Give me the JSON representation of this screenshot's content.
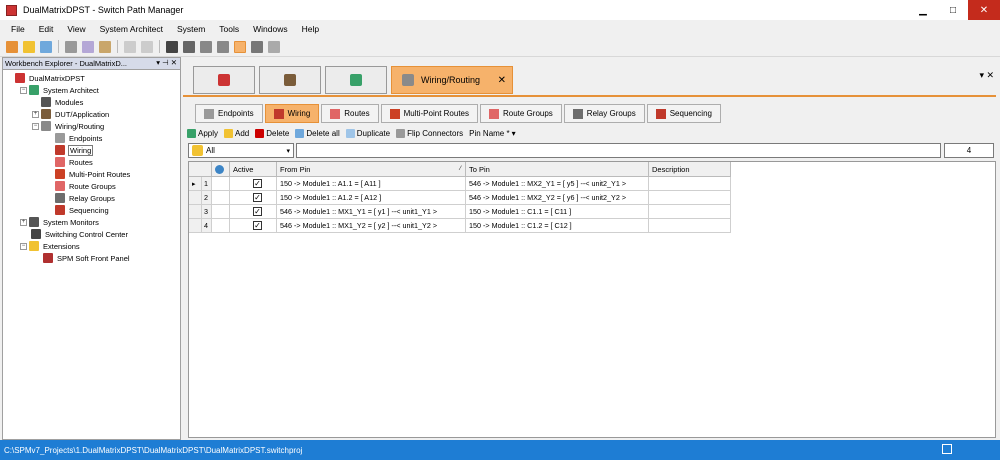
{
  "window": {
    "title": "DualMatrixDPST - Switch Path Manager",
    "minimize": "▁",
    "maximize": "□",
    "close": "✕"
  },
  "menu": [
    "File",
    "Edit",
    "View",
    "System Architect",
    "System",
    "Tools",
    "Windows",
    "Help"
  ],
  "explorer": {
    "title": "Workbench Explorer - DualMatrixD...",
    "controls": "▾ ⊣ ✕",
    "tree": [
      {
        "label": "DualMatrixDPST",
        "expander": "",
        "level": 0
      },
      {
        "label": "System Architect",
        "expander": "−",
        "level": 1
      },
      {
        "label": "Modules",
        "expander": "",
        "level": 2
      },
      {
        "label": "DUT/Application",
        "expander": "+",
        "level": 2
      },
      {
        "label": "Wiring/Routing",
        "expander": "−",
        "level": 2
      },
      {
        "label": "Endpoints",
        "expander": "",
        "level": 3
      },
      {
        "label": "Wiring",
        "expander": "",
        "level": 3,
        "selected": true
      },
      {
        "label": "Routes",
        "expander": "",
        "level": 3
      },
      {
        "label": "Multi-Point Routes",
        "expander": "",
        "level": 3
      },
      {
        "label": "Route Groups",
        "expander": "",
        "level": 3
      },
      {
        "label": "Relay Groups",
        "expander": "",
        "level": 3
      },
      {
        "label": "Sequencing",
        "expander": "",
        "level": 3
      },
      {
        "label": "System Monitors",
        "expander": "+",
        "level": 1
      },
      {
        "label": "Switching Control Center",
        "expander": "",
        "level": 1
      },
      {
        "label": "Extensions",
        "expander": "−",
        "level": 1
      },
      {
        "label": "SPM Soft Front Panel",
        "expander": "",
        "level": 2
      }
    ]
  },
  "doc_tabs": {
    "active_label": "Wiring/Routing",
    "close": "✕",
    "panel_control": "▾ ✕"
  },
  "sub_tabs": [
    {
      "label": "Endpoints",
      "icon": "endpoints-icon"
    },
    {
      "label": "Wiring",
      "icon": "wiring-icon",
      "active": true
    },
    {
      "label": "Routes",
      "icon": "routes-icon"
    },
    {
      "label": "Multi-Point Routes",
      "icon": "multi-point-routes-icon"
    },
    {
      "label": "Route Groups",
      "icon": "route-groups-icon"
    },
    {
      "label": "Relay Groups",
      "icon": "relay-groups-icon"
    },
    {
      "label": "Sequencing",
      "icon": "sequencing-icon"
    }
  ],
  "actions": {
    "apply": "Apply",
    "add": "Add",
    "delete": "Delete",
    "delete_all": "Delete all",
    "duplicate": "Duplicate",
    "flip": "Flip Connectors",
    "pin_name": "Pin Name *",
    "pin_name_arrow": "▾"
  },
  "filter": {
    "value": "All",
    "count": "4",
    "dropdown": "▾"
  },
  "grid": {
    "headers": {
      "active": "Active",
      "from_pin": "From Pin",
      "to_pin": "To Pin",
      "description": "Description"
    },
    "rows": [
      {
        "indicator": "▸",
        "num": "1",
        "active": "✓",
        "from": "150 -> Module1 :: A1.1  = [ A11 ]",
        "to": "546 -> Module1 :: MX2_Y1  = [ y5 ] --< unit2_Y1 >",
        "desc": ""
      },
      {
        "indicator": "",
        "num": "2",
        "active": "✓",
        "from": "150 -> Module1 :: A1.2  = [ A12 ]",
        "to": "546 -> Module1 :: MX2_Y2  = [ y6 ] --< unit2_Y2 >",
        "desc": ""
      },
      {
        "indicator": "",
        "num": "3",
        "active": "✓",
        "from": "546 -> Module1 :: MX1_Y1  = [ y1 ] --< unit1_Y1 >",
        "to": "150 -> Module1 :: C1.1  = [ C11 ]",
        "desc": ""
      },
      {
        "indicator": "",
        "num": "4",
        "active": "✓",
        "from": "546 -> Module1 :: MX1_Y2  = [ y2 ] --< unit1_Y2 >",
        "to": "150 -> Module1 :: C1.2  = [ C12 ]",
        "desc": ""
      }
    ]
  },
  "status": {
    "path": "C:\\SPMv7_Projects\\1.DualMatrixDPST\\DualMatrixDPST\\DualMatrixDPST.switchproj"
  },
  "colors": {
    "accent": "#f6b26b",
    "status_bar": "#1e7dd4",
    "close_button": "#c42b1c"
  }
}
